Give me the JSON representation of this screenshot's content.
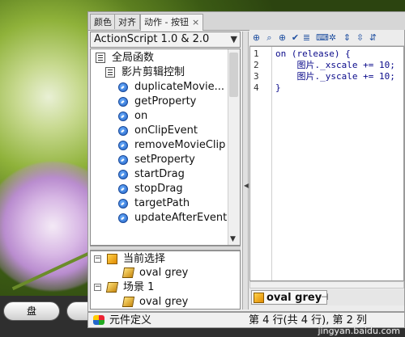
{
  "tabs": [
    {
      "label": "颜色"
    },
    {
      "label": "对齐"
    },
    {
      "label": "动作 - 按钮"
    }
  ],
  "toolbox": {
    "dropdown_label": "ActionScript 1.0 & 2.0",
    "items": [
      {
        "label": "全局函数"
      },
      {
        "label": "影片剪辑控制"
      },
      {
        "label": "duplicateMovie..."
      },
      {
        "label": "getProperty"
      },
      {
        "label": "on"
      },
      {
        "label": "onClipEvent"
      },
      {
        "label": "removeMovieClip"
      },
      {
        "label": "setProperty"
      },
      {
        "label": "startDrag"
      },
      {
        "label": "stopDrag"
      },
      {
        "label": "targetPath"
      },
      {
        "label": "updateAfterEvent"
      }
    ]
  },
  "scene_tree": {
    "current_selection": "当前选择",
    "selection_item": "oval grey",
    "scene": "场景 1",
    "scene_item": "oval grey",
    "symbol_defs": "元件定义"
  },
  "editor": {
    "line_numbers": [
      "1",
      "2",
      "3",
      "4"
    ],
    "lines": [
      "on (release) {",
      "    图片._xscale += 10;",
      "    图片._yscale += 10;",
      "}"
    ]
  },
  "bottom_tab_label": "oval grey",
  "status": "第 4 行(共 4 行), 第 2 列",
  "taskbar": {
    "oval_button_label": "盘"
  },
  "watermark": "jingyan.baidu.com"
}
